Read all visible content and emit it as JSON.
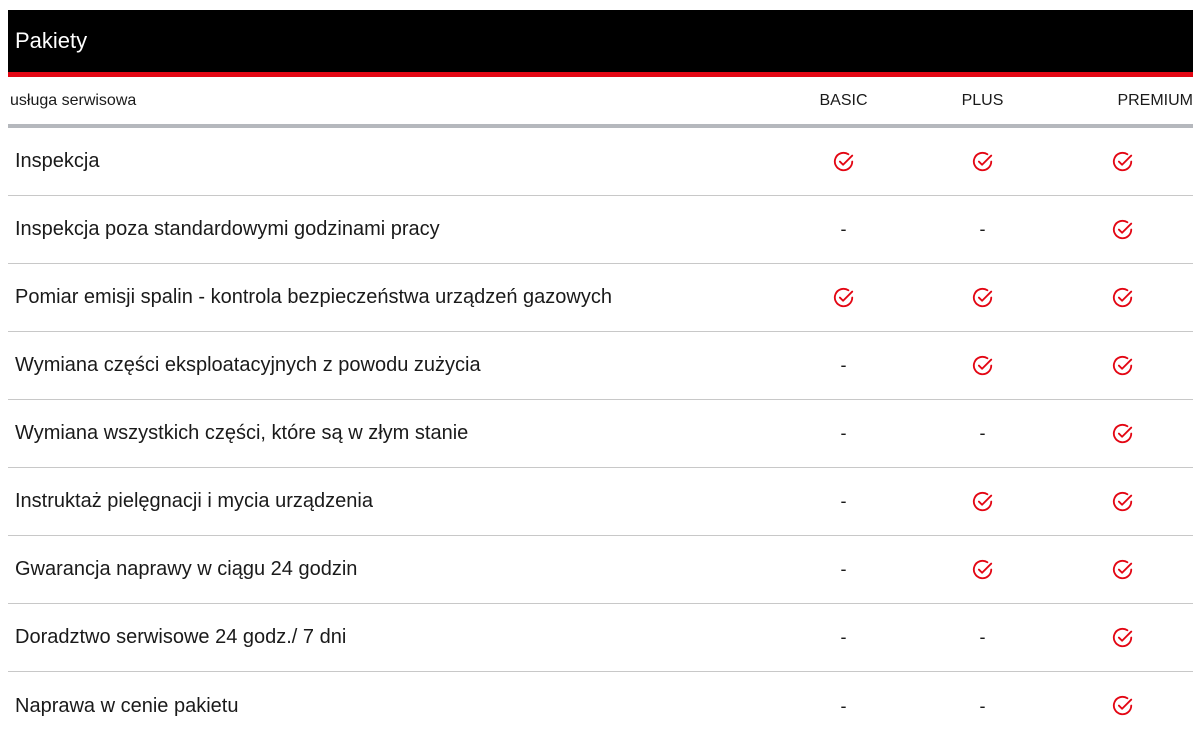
{
  "title": "Pakiety",
  "accent_color": "#e30613",
  "header": {
    "service_label": "usługa serwisowa",
    "plans": [
      "BASIC",
      "PLUS",
      "PREMIUM"
    ]
  },
  "rows": [
    {
      "service": "Inspekcja",
      "basic": "check",
      "plus": "check",
      "premium": "check"
    },
    {
      "service": "Inspekcja poza standardowymi godzinami pracy",
      "basic": "-",
      "plus": "-",
      "premium": "check"
    },
    {
      "service": "Pomiar emisji spalin - kontrola bezpieczeństwa urządzeń gazowych",
      "basic": "check",
      "plus": "check",
      "premium": "check"
    },
    {
      "service": "Wymiana części eksploatacyjnych z powodu zużycia",
      "basic": "-",
      "plus": "check",
      "premium": "check"
    },
    {
      "service": "Wymiana wszystkich części, które są w złym stanie",
      "basic": "-",
      "plus": "-",
      "premium": "check"
    },
    {
      "service": "Instruktaż pielęgnacji i mycia urządzenia",
      "basic": "-",
      "plus": "check",
      "premium": "check"
    },
    {
      "service": "Gwarancja naprawy w ciągu 24 godzin",
      "basic": "-",
      "plus": "check",
      "premium": "check"
    },
    {
      "service": "Doradztwo serwisowe 24 godz./ 7 dni",
      "basic": "-",
      "plus": "-",
      "premium": "check"
    },
    {
      "service": "Naprawa w cenie pakietu",
      "basic": "-",
      "plus": "-",
      "premium": "check"
    }
  ]
}
